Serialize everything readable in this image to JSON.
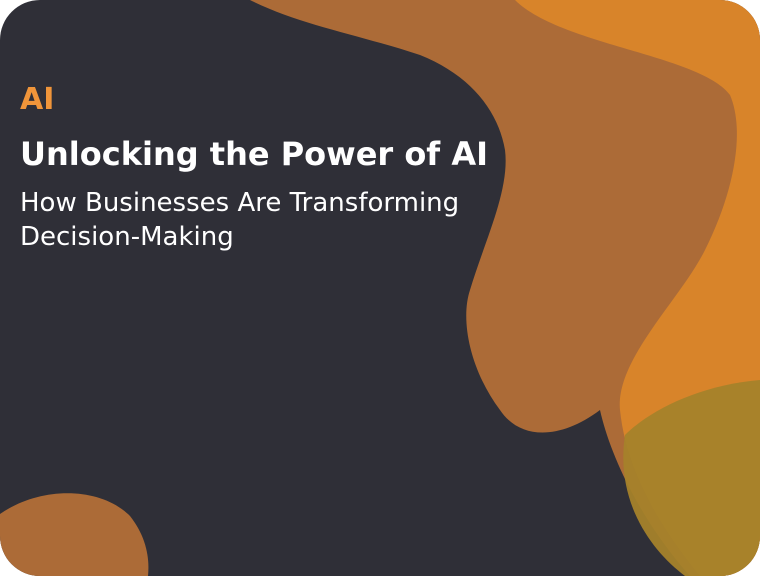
{
  "category": "AI",
  "title": "Unlocking the Power of AI",
  "subtitle": "How Businesses Are Transforming Decision-Making",
  "colors": {
    "background": "#2f2f37",
    "accent": "#f0953a",
    "blob_brown": "#ac6b37",
    "blob_orange": "#df8828",
    "blob_olive": "#a5822a"
  }
}
